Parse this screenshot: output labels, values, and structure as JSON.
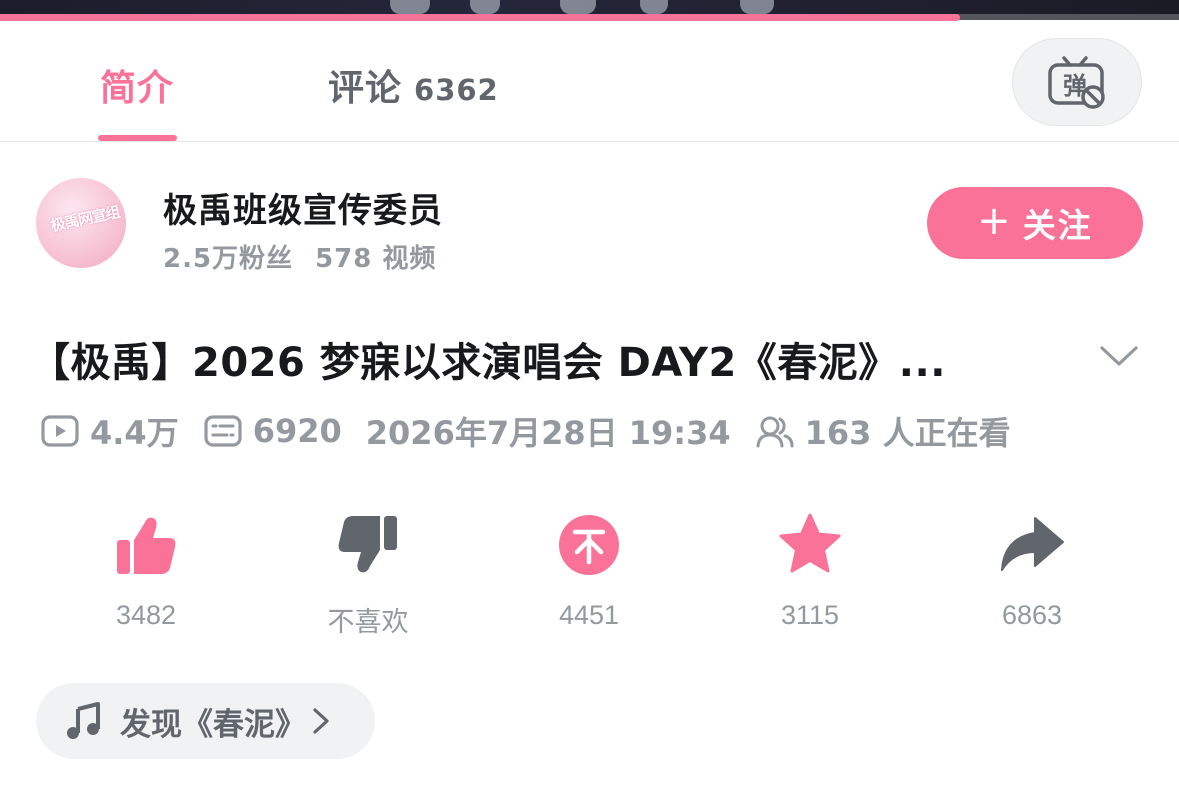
{
  "player": {
    "progress": 0.814
  },
  "tabs": {
    "intro_label": "简介",
    "comments_label": "评论",
    "comments_count": "6362",
    "active": "intro"
  },
  "danmaku": {
    "icon": "danmaku-off-icon",
    "glyph": "弹"
  },
  "uploader": {
    "avatar_text": "极禹网宣组",
    "name": "极禹班级宣传委员",
    "fans": "2.5万粉丝",
    "videos": "578 视频",
    "follow_label": "关注"
  },
  "video": {
    "title": "【极禹】2026 梦寐以求演唱会 DAY2《春泥》...",
    "views": "4.4万",
    "danmaku_count": "6920",
    "datetime": "2026年7月28日 19:34",
    "watching": "163 人正在看"
  },
  "actions": {
    "like": {
      "label": "3482",
      "icon": "thumbs-up-icon"
    },
    "dislike": {
      "label": "不喜欢",
      "icon": "thumbs-down-icon"
    },
    "coin": {
      "label": "4451",
      "icon": "coin-icon"
    },
    "favorite": {
      "label": "3115",
      "icon": "star-icon"
    },
    "share": {
      "label": "6863",
      "icon": "share-icon"
    }
  },
  "music": {
    "label": "发现《春泥》"
  },
  "colors": {
    "accent": "#fb7299",
    "text_primary": "#18191c",
    "text_secondary": "#9499a0",
    "icon_dark": "#61666d",
    "chip_bg": "#f1f2f3"
  }
}
